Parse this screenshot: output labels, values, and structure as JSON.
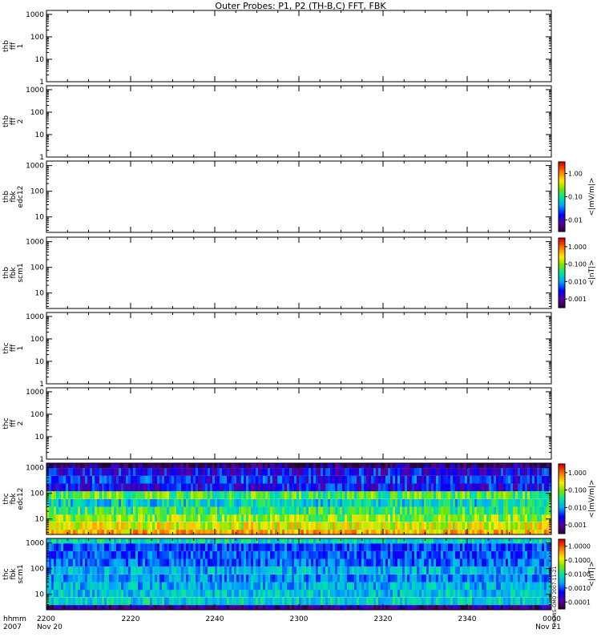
{
  "title": "Outer Probes: P1, P2 (TH-B,C) FFT, FBK",
  "time_axis": {
    "row_labels": [
      "hhmm",
      "2007"
    ],
    "ticks": [
      {
        "label": "2200",
        "sub": "Nov 20"
      },
      {
        "label": "2220",
        "sub": ""
      },
      {
        "label": "2240",
        "sub": ""
      },
      {
        "label": "2300",
        "sub": ""
      },
      {
        "label": "2320",
        "sub": ""
      },
      {
        "label": "2340",
        "sub": ""
      },
      {
        "label": "0000",
        "sub": "Nov 21"
      }
    ]
  },
  "panels": [
    {
      "ylabel": [
        "thb",
        "fff",
        "1"
      ],
      "ytick_labels": [
        "1",
        "10",
        "100",
        "1000"
      ],
      "has_data": false,
      "colorbar": null
    },
    {
      "ylabel": [
        "thb",
        "fff",
        "2"
      ],
      "ytick_labels": [
        "1",
        "10",
        "100",
        "1000"
      ],
      "has_data": false,
      "colorbar": null
    },
    {
      "ylabel": [
        "thb",
        "fbk",
        "edc12"
      ],
      "ytick_labels": [
        "10",
        "100",
        "1000"
      ],
      "has_data": false,
      "colorbar": {
        "label": "<|mV/m|>",
        "ticks": [
          "0.01",
          "0.10",
          "1.00"
        ]
      }
    },
    {
      "ylabel": [
        "thb",
        "fbk",
        "scm1"
      ],
      "ytick_labels": [
        "10",
        "100",
        "1000"
      ],
      "has_data": false,
      "colorbar": {
        "label": "<|nT|>",
        "ticks": [
          "0.001",
          "0.010",
          "0.100",
          "1.000"
        ]
      }
    },
    {
      "ylabel": [
        "thc",
        "fff",
        "1"
      ],
      "ytick_labels": [
        "1",
        "10",
        "100",
        "1000"
      ],
      "has_data": false,
      "colorbar": null
    },
    {
      "ylabel": [
        "thc",
        "fff",
        "2"
      ],
      "ytick_labels": [
        "1",
        "10",
        "100",
        "1000"
      ],
      "has_data": false,
      "colorbar": null
    },
    {
      "ylabel": [
        "thc",
        "fbk",
        "edc12"
      ],
      "ytick_labels": [
        "10",
        "100",
        "1000"
      ],
      "has_data": true,
      "colorbar": {
        "label": "<|mV/m|>",
        "ticks": [
          "0.001",
          "0.010",
          "0.100",
          "1.000"
        ]
      }
    },
    {
      "ylabel": [
        "thc",
        "fbk",
        "scm1"
      ],
      "ytick_labels": [
        "10",
        "100",
        "1000"
      ],
      "has_data": true,
      "colorbar": {
        "label": "<|nT|>",
        "ticks": [
          "0.0001",
          "0.0010",
          "0.0100",
          "0.1000",
          "1.0000"
        ]
      }
    }
  ],
  "side_note": "THEMIS-GMO 2007-11-21",
  "chart_data": [
    {
      "type": "heatmap",
      "panel": "thb fff 1",
      "ylabel": "thb fff 1",
      "ylim": [
        1,
        1500
      ],
      "yscale": "log",
      "x": [
        "2200",
        "2220",
        "2240",
        "2300",
        "2320",
        "2340",
        "0000"
      ],
      "values": []
    },
    {
      "type": "heatmap",
      "panel": "thb fff 2",
      "ylabel": "thb fff 2",
      "ylim": [
        1,
        1500
      ],
      "yscale": "log",
      "x": [
        "2200",
        "2220",
        "2240",
        "2300",
        "2320",
        "2340",
        "0000"
      ],
      "values": []
    },
    {
      "type": "heatmap",
      "panel": "thb fbk edc12",
      "ylabel": "thb fbk edc12",
      "ylim": [
        2.5,
        1500
      ],
      "yscale": "log",
      "colorbar": "<|mV/m|>",
      "values": []
    },
    {
      "type": "heatmap",
      "panel": "thb fbk scm1",
      "ylabel": "thb fbk scm1",
      "ylim": [
        2.5,
        1500
      ],
      "yscale": "log",
      "colorbar": "<|nT|>",
      "values": []
    },
    {
      "type": "heatmap",
      "panel": "thc fff 1",
      "ylabel": "thc fff 1",
      "ylim": [
        1,
        1500
      ],
      "yscale": "log",
      "values": []
    },
    {
      "type": "heatmap",
      "panel": "thc fff 2",
      "ylabel": "thc fff 2",
      "ylim": [
        1,
        1500
      ],
      "yscale": "log",
      "values": []
    },
    {
      "type": "heatmap",
      "panel": "thc fbk edc12",
      "ylabel": "thc fbk edc12",
      "ylim": [
        2.5,
        1500
      ],
      "yscale": "log",
      "colorbar": "<|mV/m|>",
      "color_scale": "log",
      "color_range": [
        0.0005,
        1.5
      ],
      "bands_hz": [
        2.7,
        5.4,
        11,
        21,
        42,
        85,
        170,
        340,
        680,
        1350
      ],
      "band_typical_values": [
        0.3,
        0.15,
        0.08,
        0.04,
        0.02,
        0.05,
        0.003,
        0.004,
        0.003,
        0.001
      ]
    },
    {
      "type": "heatmap",
      "panel": "thc fbk scm1",
      "ylabel": "thc fbk scm1",
      "ylim": [
        2.5,
        1500
      ],
      "yscale": "log",
      "colorbar": "<|nT|>",
      "color_scale": "log",
      "color_range": [
        5e-05,
        1.5
      ],
      "bands_hz": [
        2.7,
        5.4,
        11,
        21,
        42,
        85,
        170,
        340,
        680,
        1350
      ],
      "band_typical_values": [
        0.0002,
        0.005,
        0.004,
        0.003,
        0.002,
        0.003,
        0.0015,
        0.0012,
        0.001,
        0.006
      ]
    }
  ]
}
